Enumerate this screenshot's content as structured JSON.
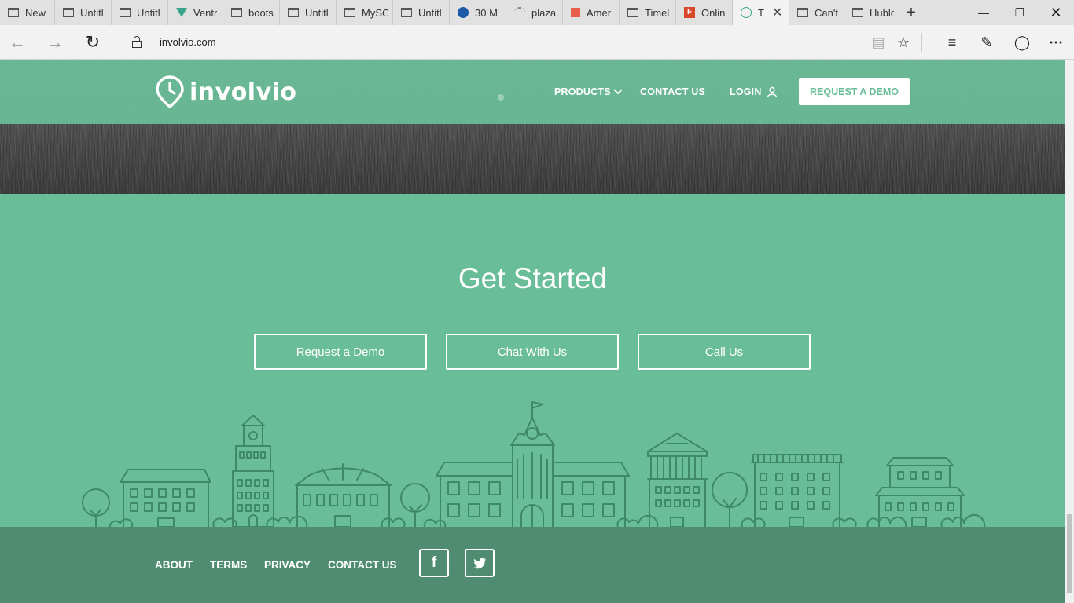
{
  "browser": {
    "tabs": [
      {
        "label": "New",
        "icon": "page-icon"
      },
      {
        "label": "Untitl",
        "icon": "page-icon"
      },
      {
        "label": "Untitl",
        "icon": "page-icon"
      },
      {
        "label": "Ventr",
        "icon": "vue-icon"
      },
      {
        "label": "boots",
        "icon": "page-icon"
      },
      {
        "label": "Untitl",
        "icon": "page-icon"
      },
      {
        "label": "MySC",
        "icon": "page-icon"
      },
      {
        "label": "Untitl",
        "icon": "page-icon"
      },
      {
        "label": "30 M",
        "icon": "blue-circle-icon"
      },
      {
        "label": "plaza",
        "icon": "loading-icon"
      },
      {
        "label": "Amer",
        "icon": "red-square-icon"
      },
      {
        "label": "Timel",
        "icon": "page-icon"
      },
      {
        "label": "Onlin",
        "icon": "f-icon"
      },
      {
        "label": "T",
        "icon": "clock-icon",
        "active": true
      },
      {
        "label": "Can't",
        "icon": "page-icon"
      },
      {
        "label": "Hublo",
        "icon": "page-icon"
      }
    ],
    "url": "involvio.com"
  },
  "site": {
    "logo_text": "involvio",
    "nav": {
      "products": "PRODUCTS",
      "contact": "CONTACT US",
      "login": "LOGIN",
      "demo": "REQUEST A DEMO"
    },
    "get_started": {
      "title": "Get Started",
      "buttons": [
        "Request a Demo",
        "Chat With Us",
        "Call Us"
      ]
    },
    "footer": {
      "links": [
        "ABOUT",
        "TERMS",
        "PRIVACY",
        "CONTACT US"
      ],
      "social": [
        "f"
      ]
    }
  },
  "colors": {
    "brand_green": "#6abd99",
    "footer_green": "#4f8c72",
    "line_green": "#3e8a67"
  }
}
